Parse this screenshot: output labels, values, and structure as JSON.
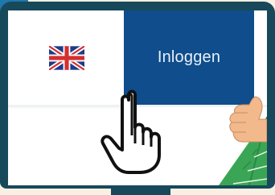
{
  "login": {
    "label": "Inloggen"
  },
  "language": {
    "flag_icon": "union-jack-flag-icon"
  },
  "colors": {
    "background": "#f8f0e2",
    "monitor_frame": "#17495a",
    "badge": "#1f78ad",
    "login_button": "#0f4d8c",
    "plant": "#3aa655"
  },
  "icons": [
    "hand-pointer-icon",
    "thumbs-up-icon"
  ]
}
